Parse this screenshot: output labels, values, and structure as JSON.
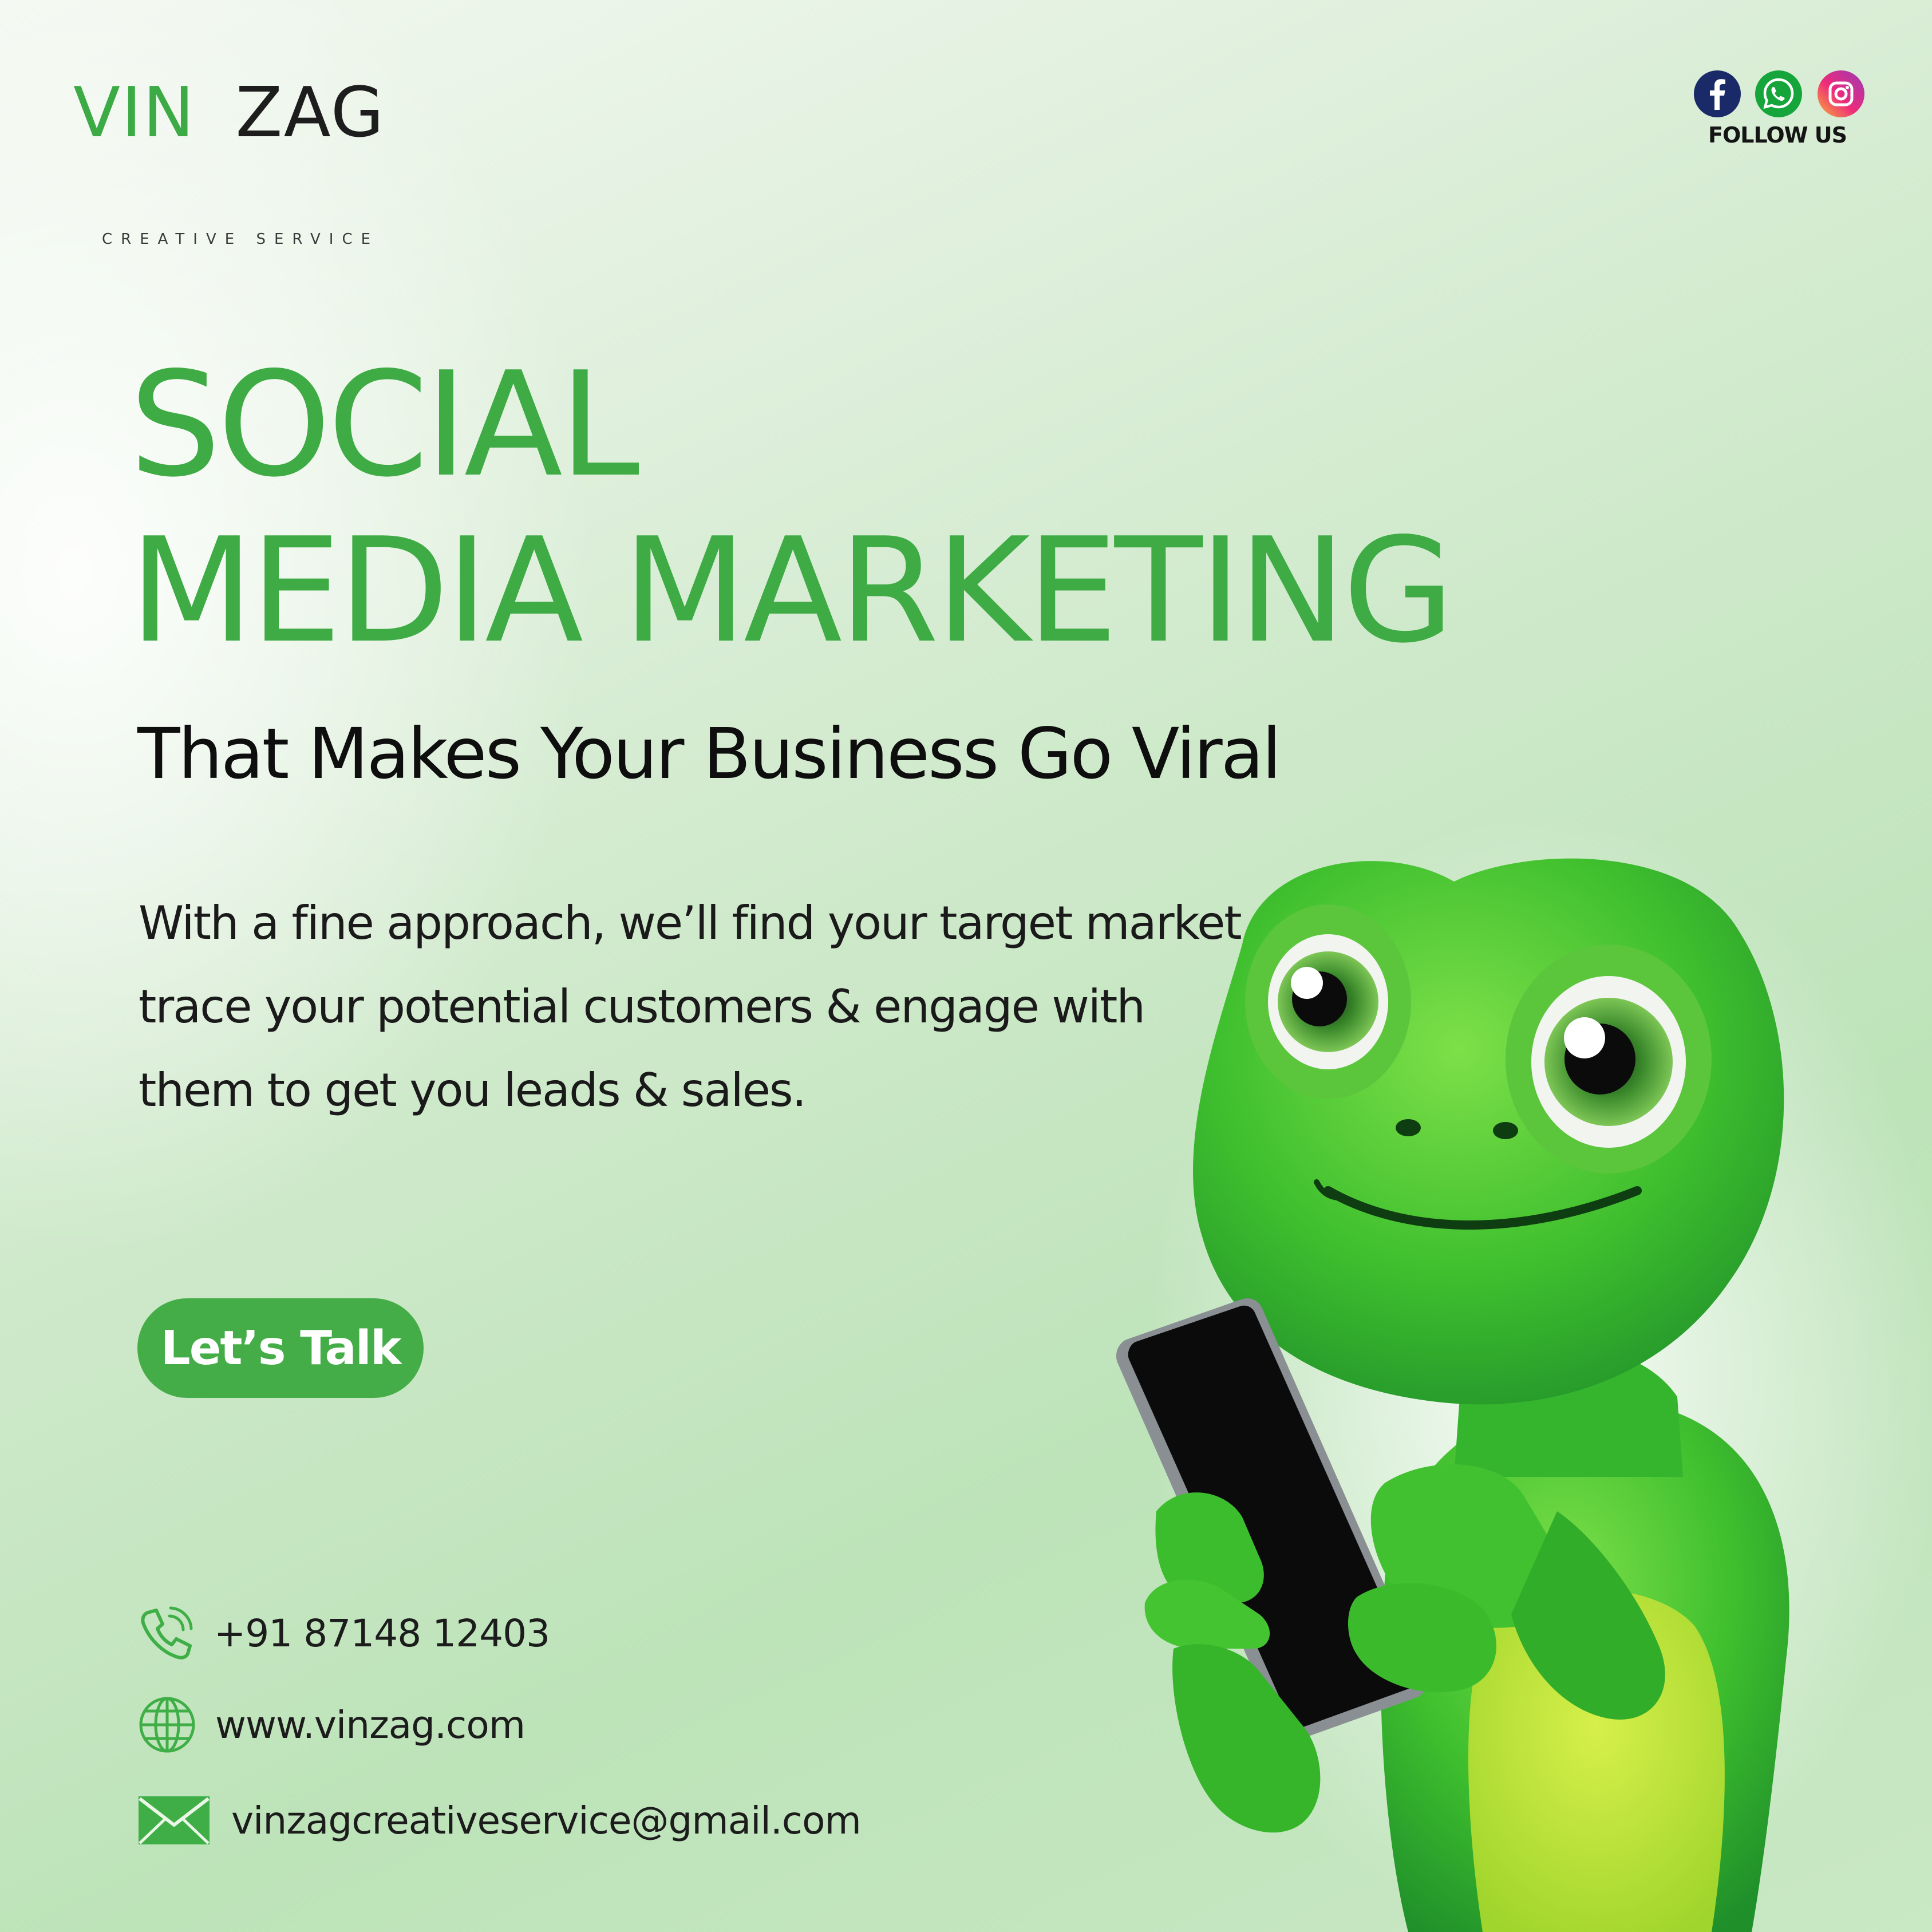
{
  "brand": {
    "name_part1": "VIN",
    "name_part2": "ZAG",
    "tagline": "CREATIVE SERVICE",
    "primary_color": "#3eab45",
    "accent_color": "#44ad48"
  },
  "social": {
    "icons": [
      "facebook-icon",
      "whatsapp-icon",
      "instagram-icon"
    ],
    "follow_label": "FOLLOW US"
  },
  "headline": {
    "line1": "SOCIAL",
    "line2": "MEDIA MARKETING"
  },
  "subheadline": "That Makes Your Business Go Viral",
  "description": "With a fine approach, we’ll find your target market, trace your potential customers & engage with them to get you leads & sales.",
  "cta": {
    "label": "Let’s Talk"
  },
  "contact": {
    "phone": "+91 87148 12403",
    "website": "www.vinzag.com",
    "email": "vinzagcreativeservice@gmail.com"
  },
  "illustration": {
    "subject": "green-chameleon-mascot-holding-smartphone"
  }
}
